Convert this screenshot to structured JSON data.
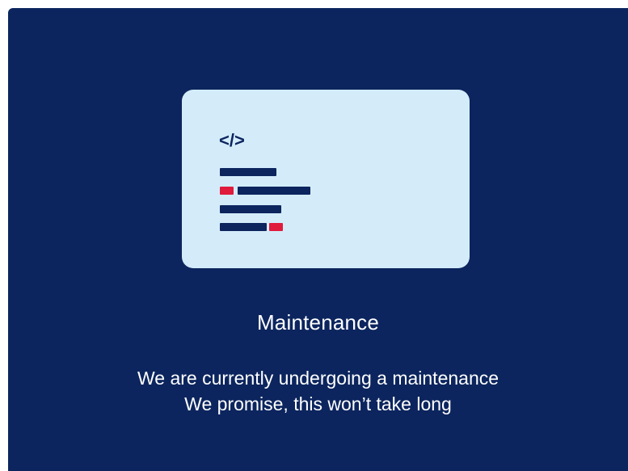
{
  "illustration": {
    "code_icon_glyph": "</>",
    "icon": "code-icon",
    "colors": {
      "card_bg": "#d4ecfa",
      "code_line": "#0c255e",
      "accent": "#e01b3c"
    }
  },
  "maintenance": {
    "title": "Maintenance",
    "message_line_1": "We are currently undergoing a maintenance",
    "message_line_2": "We promise, this won’t take long"
  },
  "theme": {
    "background": "#0c255e",
    "text": "#ffffff"
  }
}
